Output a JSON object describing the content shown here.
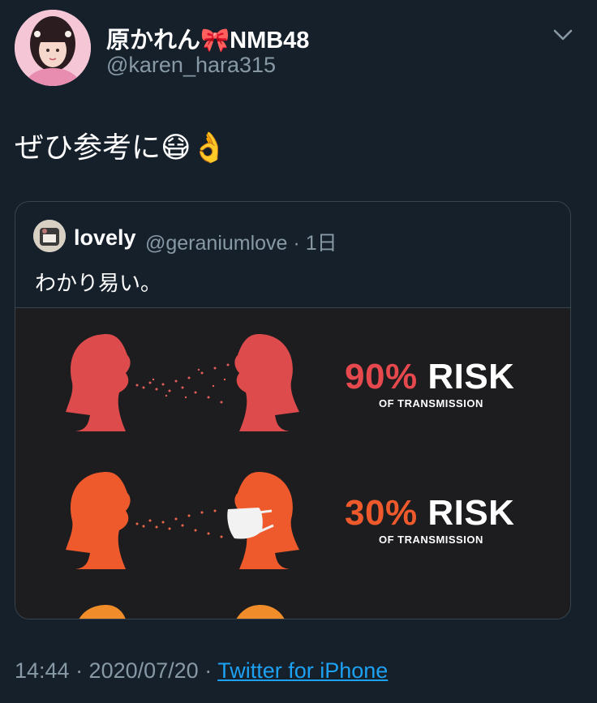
{
  "author": {
    "display_name_prefix": "原かれん",
    "display_name_suffix": "NMB48",
    "ribbon_emoji": "🎀",
    "handle": "@karen_hara315"
  },
  "tweet": {
    "text": "ぜひ参考に",
    "emoji": [
      "😷",
      "👌"
    ]
  },
  "quoted": {
    "name": "lovely",
    "handle": "@geraniumlove",
    "time": "· 1日",
    "text": "わかり易い。",
    "image": {
      "rows": [
        {
          "percent": "90%",
          "label": "RISK",
          "sub": "OF TRANSMISSION",
          "color": "#e0474b"
        },
        {
          "percent": "30%",
          "label": "RISK",
          "sub": "OF TRANSMISSION",
          "color": "#ee5b2e"
        }
      ]
    }
  },
  "footer": {
    "timestamp": "14:44 · 2020/07/20 ·",
    "source": "Twitter for iPhone"
  },
  "colors": {
    "background": "#15202b",
    "secondary_text": "#8899a6",
    "link": "#1da1f2"
  }
}
